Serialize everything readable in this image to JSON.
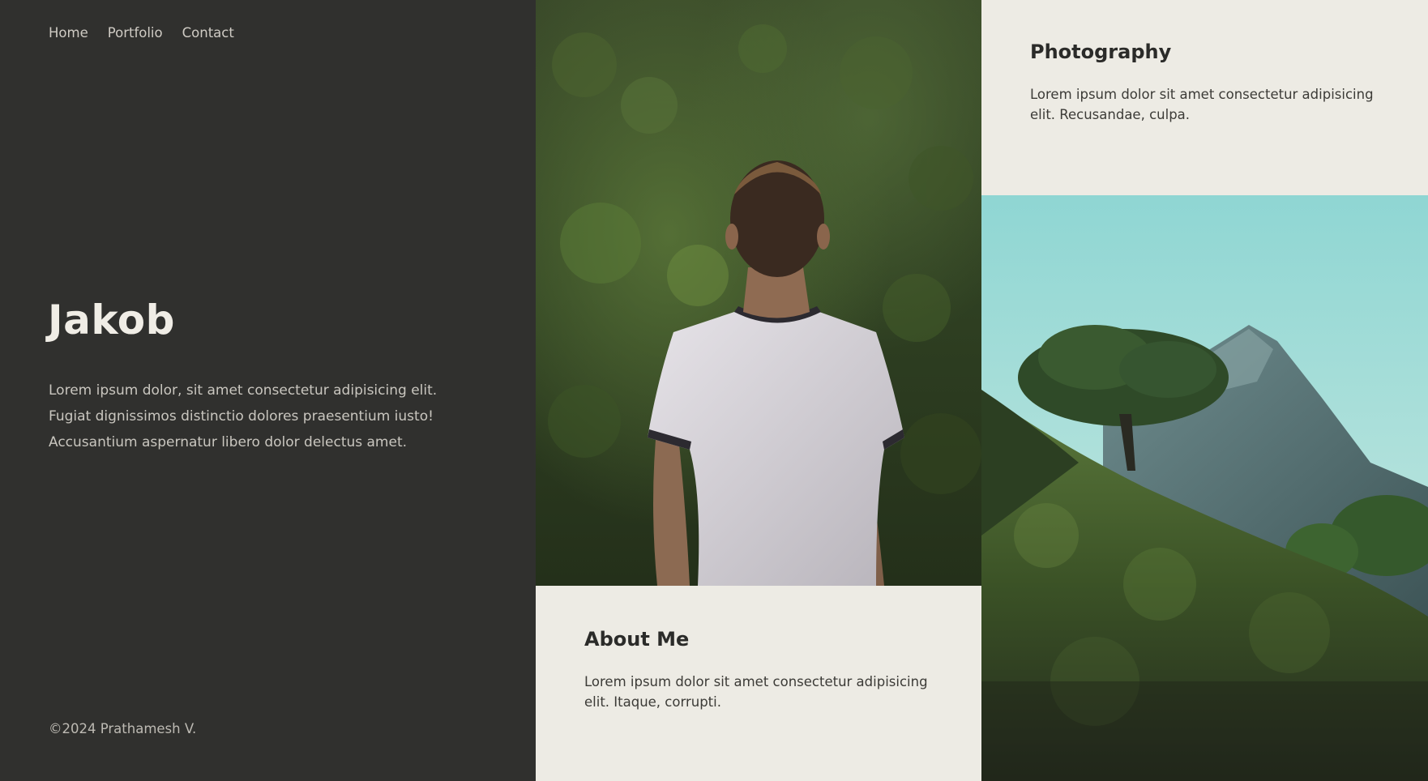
{
  "nav": {
    "items": [
      {
        "label": "Home"
      },
      {
        "label": "Portfolio"
      },
      {
        "label": "Contact"
      }
    ]
  },
  "hero": {
    "title": "Jakob",
    "text": "Lorem ipsum dolor, sit amet consectetur adipisicing elit. Fugiat dignissimos distinctio dolores praesentium iusto! Accusantium aspernatur libero dolor delectus amet."
  },
  "footer": {
    "copyright": "©2024 Prathamesh V."
  },
  "cards": {
    "photography": {
      "title": "Photography",
      "text": "Lorem ipsum dolor sit amet consectetur adipisicing elit. Recusandae, culpa."
    },
    "about": {
      "title": "About Me",
      "text": "Lorem ipsum dolor sit amet consectetur adipisicing elit. Itaque, corrupti."
    }
  },
  "colors": {
    "left_panel_bg": "#30302e",
    "card_bg": "#edebe4",
    "heading_light": "#f0ede6",
    "heading_dark": "#2b2b29",
    "sky": "#96d6d6",
    "forest": "#2e3e20"
  }
}
